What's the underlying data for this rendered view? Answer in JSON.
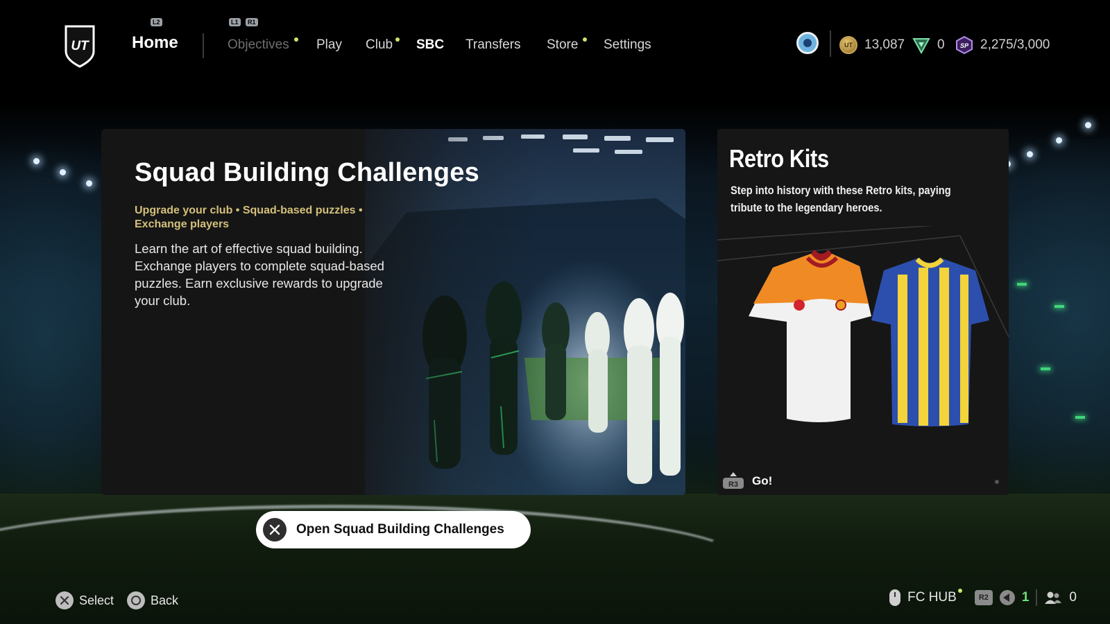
{
  "nav": {
    "home": "Home",
    "l2": "L2",
    "l1": "L1",
    "r1": "R1",
    "tabs": [
      {
        "label": "Objectives"
      },
      {
        "label": "Play"
      },
      {
        "label": "Club"
      },
      {
        "label": "SBC"
      },
      {
        "label": "Transfers"
      },
      {
        "label": "Store"
      },
      {
        "label": "Settings"
      }
    ]
  },
  "logo_text": "UT",
  "currencies": {
    "coins": "13,087",
    "fc_points": "0",
    "season_points": "2,275/3,000",
    "coin_icon_text": "UT",
    "sp_icon_text": "SP"
  },
  "sbc_card": {
    "title": "Squad Building Challenges",
    "tags": "Upgrade your club • Squad-based puzzles • Exchange players",
    "description": "Learn the art of effective squad building. Exchange players to complete squad-based puzzles. Earn exclusive rewards to upgrade your club."
  },
  "kits_card": {
    "title": "Retro Kits",
    "description": "Step into history with these Retro kits, paying tribute to the legendary heroes.",
    "footer_label": "Go!",
    "footer_button": "R3"
  },
  "action": {
    "label": "Open Squad Building Challenges"
  },
  "bottom": {
    "select": "Select",
    "back": "Back",
    "hub": "FC HUB",
    "r2": "R2",
    "notifications": "1",
    "friends": "0"
  },
  "colors": {
    "accent_tag": "#d4c07a",
    "new_dot": "#c8e86a",
    "notification_green": "#6ee07a"
  }
}
